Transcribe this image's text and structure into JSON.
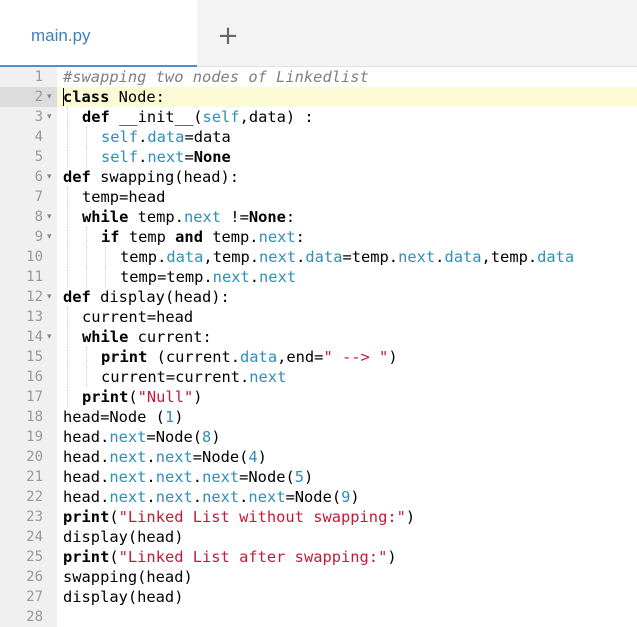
{
  "tabs": {
    "active_label": "main.py",
    "add_symbol": "+"
  },
  "editor": {
    "active_line": 2,
    "lines": [
      {
        "n": "1",
        "fold": false,
        "indent": 0,
        "tokens": [
          [
            "cm",
            "#swapping two nodes of Linkedlist"
          ]
        ]
      },
      {
        "n": "2",
        "fold": true,
        "indent": 0,
        "tokens": [
          [
            "kw",
            "class"
          ],
          [
            "p",
            " Node:"
          ]
        ]
      },
      {
        "n": "3",
        "fold": true,
        "indent": 1,
        "tokens": [
          [
            "kw",
            "def"
          ],
          [
            "p",
            " __init__("
          ],
          [
            "at",
            "self"
          ],
          [
            "p",
            ",data) :"
          ]
        ]
      },
      {
        "n": "4",
        "fold": false,
        "indent": 2,
        "tokens": [
          [
            "at",
            "self"
          ],
          [
            "p",
            "."
          ],
          [
            "at",
            "data"
          ],
          [
            "p",
            "=data"
          ]
        ]
      },
      {
        "n": "5",
        "fold": false,
        "indent": 2,
        "tokens": [
          [
            "at",
            "self"
          ],
          [
            "p",
            "."
          ],
          [
            "at",
            "next"
          ],
          [
            "p",
            "="
          ],
          [
            "kw",
            "None"
          ]
        ]
      },
      {
        "n": "6",
        "fold": true,
        "indent": 0,
        "tokens": [
          [
            "kw",
            "def"
          ],
          [
            "p",
            " swapping(head):"
          ]
        ]
      },
      {
        "n": "7",
        "fold": false,
        "indent": 1,
        "tokens": [
          [
            "p",
            "temp=head"
          ]
        ]
      },
      {
        "n": "8",
        "fold": true,
        "indent": 1,
        "tokens": [
          [
            "kw",
            "while"
          ],
          [
            "p",
            " temp."
          ],
          [
            "at",
            "next"
          ],
          [
            "p",
            " !="
          ],
          [
            "kw",
            "None"
          ],
          [
            "p",
            ":"
          ]
        ]
      },
      {
        "n": "9",
        "fold": true,
        "indent": 2,
        "tokens": [
          [
            "kw",
            "if"
          ],
          [
            "p",
            " temp "
          ],
          [
            "kw",
            "and"
          ],
          [
            "p",
            " temp."
          ],
          [
            "at",
            "next"
          ],
          [
            "p",
            ":"
          ]
        ]
      },
      {
        "n": "10",
        "fold": false,
        "indent": 3,
        "tokens": [
          [
            "p",
            "temp."
          ],
          [
            "at",
            "data"
          ],
          [
            "p",
            ",temp."
          ],
          [
            "at",
            "next"
          ],
          [
            "p",
            "."
          ],
          [
            "at",
            "data"
          ],
          [
            "p",
            "=temp."
          ],
          [
            "at",
            "next"
          ],
          [
            "p",
            "."
          ],
          [
            "at",
            "data"
          ],
          [
            "p",
            ",temp."
          ],
          [
            "at",
            "data"
          ]
        ]
      },
      {
        "n": "11",
        "fold": false,
        "indent": 3,
        "tokens": [
          [
            "p",
            "temp=temp."
          ],
          [
            "at",
            "next"
          ],
          [
            "p",
            "."
          ],
          [
            "at",
            "next"
          ]
        ]
      },
      {
        "n": "12",
        "fold": true,
        "indent": 0,
        "tokens": [
          [
            "kw",
            "def"
          ],
          [
            "p",
            " display(head):"
          ]
        ]
      },
      {
        "n": "13",
        "fold": false,
        "indent": 1,
        "tokens": [
          [
            "p",
            "current=head"
          ]
        ]
      },
      {
        "n": "14",
        "fold": true,
        "indent": 1,
        "tokens": [
          [
            "kw",
            "while"
          ],
          [
            "p",
            " current:"
          ]
        ]
      },
      {
        "n": "15",
        "fold": false,
        "indent": 2,
        "tokens": [
          [
            "kw",
            "print"
          ],
          [
            "p",
            " (current."
          ],
          [
            "at",
            "data"
          ],
          [
            "p",
            ",end="
          ],
          [
            "st",
            "\" --> \""
          ],
          [
            "p",
            ")"
          ]
        ]
      },
      {
        "n": "16",
        "fold": false,
        "indent": 2,
        "tokens": [
          [
            "p",
            "current=current."
          ],
          [
            "at",
            "next"
          ]
        ]
      },
      {
        "n": "17",
        "fold": false,
        "indent": 1,
        "tokens": [
          [
            "kw",
            "print"
          ],
          [
            "p",
            "("
          ],
          [
            "st",
            "\"Null\""
          ],
          [
            "p",
            ")"
          ]
        ]
      },
      {
        "n": "18",
        "fold": false,
        "indent": 0,
        "tokens": [
          [
            "p",
            "head=Node ("
          ],
          [
            "nm",
            "1"
          ],
          [
            "p",
            ")"
          ]
        ]
      },
      {
        "n": "19",
        "fold": false,
        "indent": 0,
        "tokens": [
          [
            "p",
            "head."
          ],
          [
            "at",
            "next"
          ],
          [
            "p",
            "=Node("
          ],
          [
            "nm",
            "8"
          ],
          [
            "p",
            ")"
          ]
        ]
      },
      {
        "n": "20",
        "fold": false,
        "indent": 0,
        "tokens": [
          [
            "p",
            "head."
          ],
          [
            "at",
            "next"
          ],
          [
            "p",
            "."
          ],
          [
            "at",
            "next"
          ],
          [
            "p",
            "=Node("
          ],
          [
            "nm",
            "4"
          ],
          [
            "p",
            ")"
          ]
        ]
      },
      {
        "n": "21",
        "fold": false,
        "indent": 0,
        "tokens": [
          [
            "p",
            "head."
          ],
          [
            "at",
            "next"
          ],
          [
            "p",
            "."
          ],
          [
            "at",
            "next"
          ],
          [
            "p",
            "."
          ],
          [
            "at",
            "next"
          ],
          [
            "p",
            "=Node("
          ],
          [
            "nm",
            "5"
          ],
          [
            "p",
            ")"
          ]
        ]
      },
      {
        "n": "22",
        "fold": false,
        "indent": 0,
        "tokens": [
          [
            "p",
            "head."
          ],
          [
            "at",
            "next"
          ],
          [
            "p",
            "."
          ],
          [
            "at",
            "next"
          ],
          [
            "p",
            "."
          ],
          [
            "at",
            "next"
          ],
          [
            "p",
            "."
          ],
          [
            "at",
            "next"
          ],
          [
            "p",
            "=Node("
          ],
          [
            "nm",
            "9"
          ],
          [
            "p",
            ")"
          ]
        ]
      },
      {
        "n": "23",
        "fold": false,
        "indent": 0,
        "tokens": [
          [
            "kw",
            "print"
          ],
          [
            "p",
            "("
          ],
          [
            "st",
            "\"Linked List without swapping:\""
          ],
          [
            "p",
            ")"
          ]
        ]
      },
      {
        "n": "24",
        "fold": false,
        "indent": 0,
        "tokens": [
          [
            "p",
            "display(head)"
          ]
        ]
      },
      {
        "n": "25",
        "fold": false,
        "indent": 0,
        "tokens": [
          [
            "kw",
            "print"
          ],
          [
            "p",
            "("
          ],
          [
            "st",
            "\"Linked List after swapping:\""
          ],
          [
            "p",
            ")"
          ]
        ]
      },
      {
        "n": "26",
        "fold": false,
        "indent": 0,
        "tokens": [
          [
            "p",
            "swapping(head)"
          ]
        ]
      },
      {
        "n": "27",
        "fold": false,
        "indent": 0,
        "tokens": [
          [
            "p",
            "display(head)"
          ]
        ]
      },
      {
        "n": "28",
        "fold": false,
        "indent": 0,
        "tokens": []
      }
    ]
  }
}
